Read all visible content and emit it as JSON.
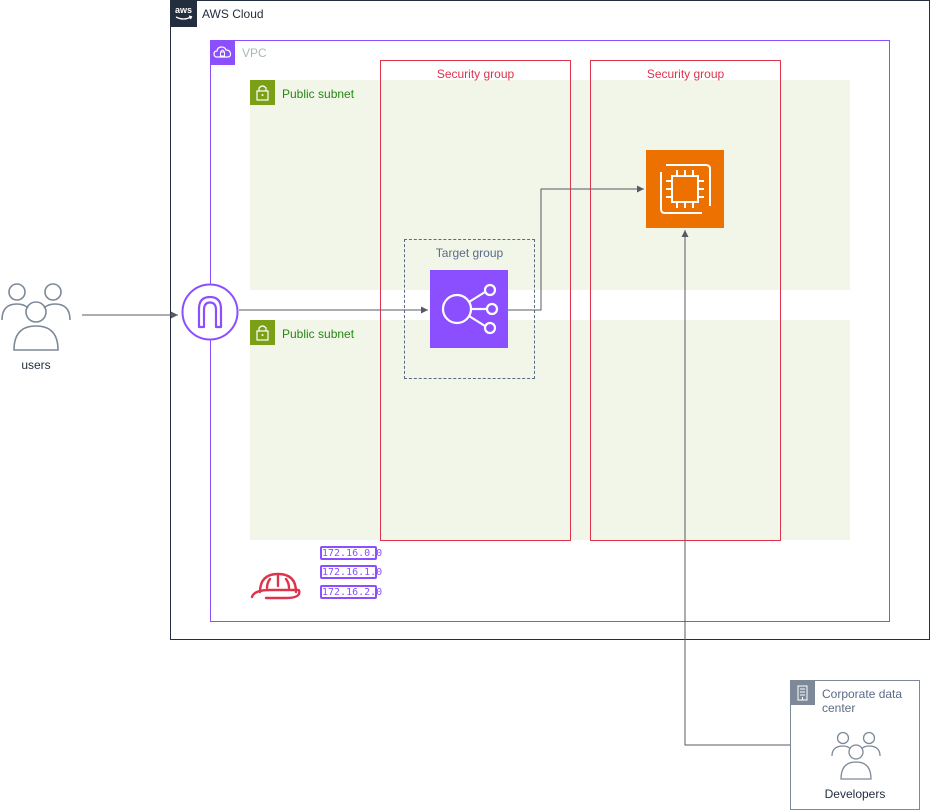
{
  "aws_cloud": {
    "label": "AWS Cloud"
  },
  "vpc": {
    "label": "VPC"
  },
  "subnets": [
    {
      "label": "Public subnet"
    },
    {
      "label": "Public subnet"
    }
  ],
  "security_groups": [
    {
      "label": "Security group"
    },
    {
      "label": "Security group"
    }
  ],
  "target_group": {
    "label": "Target group"
  },
  "users": {
    "label": "users"
  },
  "corporate_data_center": {
    "label_line1": "Corporate data",
    "label_line2": "center",
    "developers_label": "Developers"
  },
  "cidr_blocks": [
    "172.16.0.0",
    "172.16.1.0",
    "172.16.2.0"
  ],
  "icons": {
    "aws": "aws-logo-icon",
    "vpc": "vpc-cloud-icon",
    "subnet": "padlock-icon",
    "igw": "internet-gateway-icon",
    "elb": "load-balancer-icon",
    "ec2": "ec2-instance-icon",
    "users": "users-icon",
    "corp": "building-icon",
    "developers": "developers-icon",
    "helmet": "hard-hat-icon"
  },
  "colors": {
    "aws_cloud_border": "#232f3e",
    "vpc": "#8c4fff",
    "subnet_bg": "#f2f6e8",
    "subnet_icon": "#7aa116",
    "subnet_text": "#248814",
    "security_group": "#dd344c",
    "ec2": "#ed7100",
    "elb": "#8c4fff",
    "connector": "#545b64"
  }
}
